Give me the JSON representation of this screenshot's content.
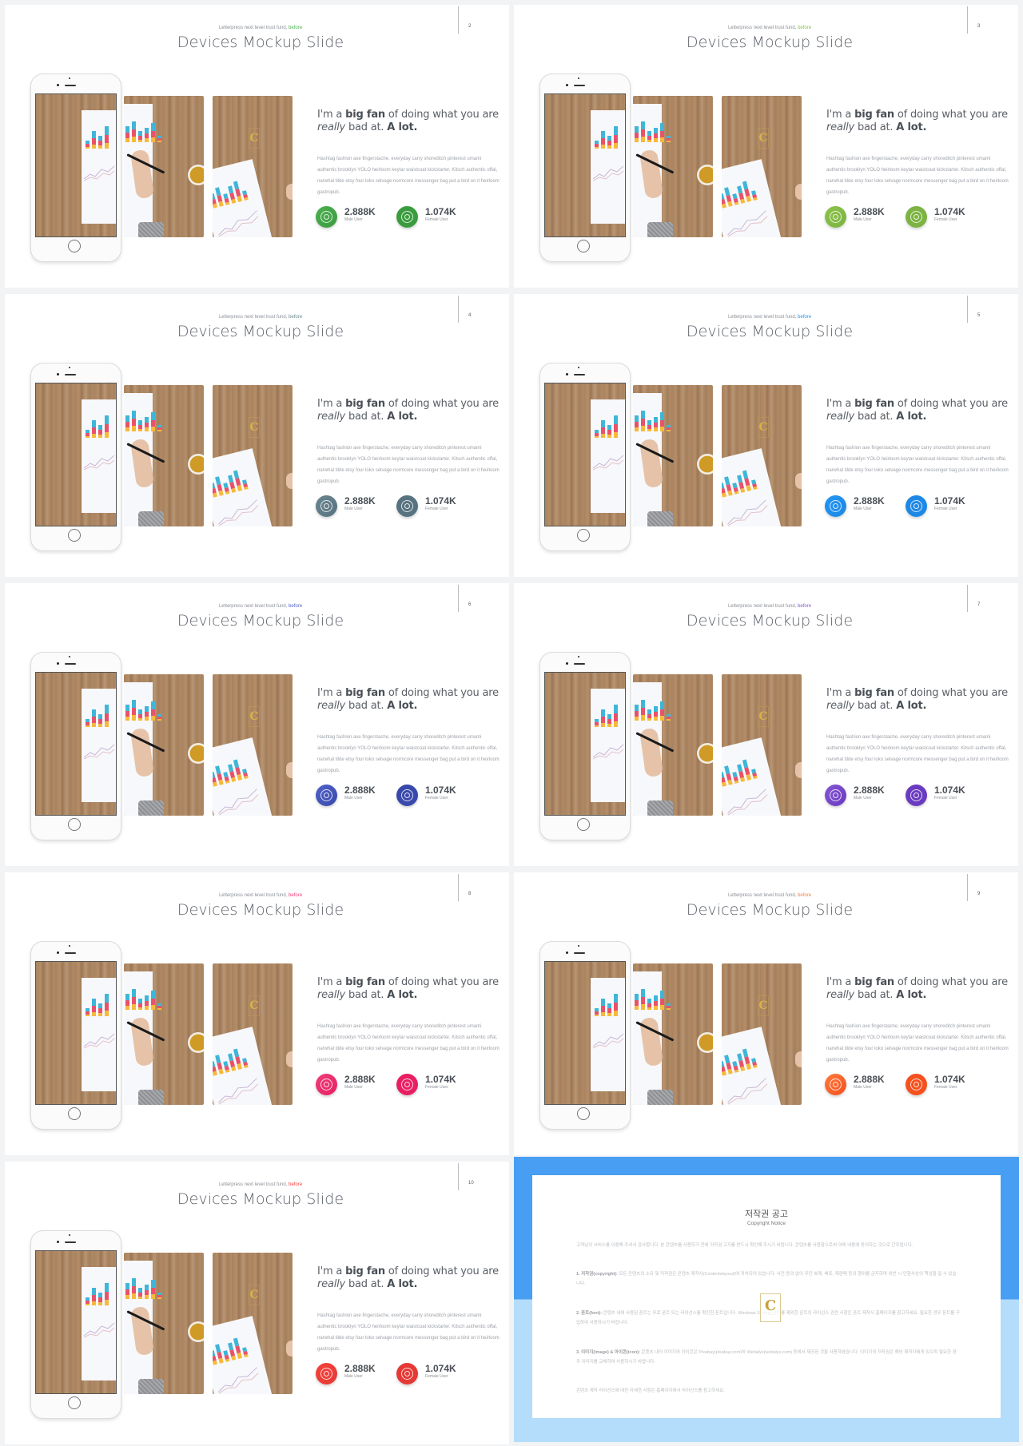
{
  "slides": [
    {
      "page": "2",
      "kicker": "Letterpress next level trust fund,",
      "kicker_accent": "before",
      "title": "Devices Mockup Slide",
      "heading_pre": "I'm a ",
      "heading_bold": "big fan",
      "heading_mid": " of doing what you are",
      "heading_em": "really",
      "heading_post": " bad at. ",
      "heading_end": "A lot.",
      "body": "Hashtag fashion axe fingerstache, everyday carry shoreditch pinterest umami authentic brooklyn YOLO heirloom keytar waistcoat kickstarter. Kitsch authentic offal, narwhal tilde etsy four loko selvage normcore messenger bag put a bird on it heirloom gastropub.",
      "stats": [
        {
          "value": "2.888K",
          "label": "Male User",
          "icon": "male-user-icon"
        },
        {
          "value": "1.074K",
          "label": "Female User",
          "icon": "female-user-icon"
        }
      ],
      "accent": "#4caf50",
      "accent_dark": "#3a9c3f"
    },
    {
      "page": "3",
      "kicker": "Letterpress next level trust fund,",
      "kicker_accent": "before",
      "title": "Devices Mockup Slide",
      "heading_pre": "I'm a ",
      "heading_bold": "big fan",
      "heading_mid": " of doing what you are",
      "heading_em": "really",
      "heading_post": " bad at. ",
      "heading_end": "A lot.",
      "body": "Hashtag fashion axe fingerstache, everyday carry shoreditch pinterest umami authentic brooklyn YOLO heirloom keytar waistcoat kickstarter. Kitsch authentic offal, narwhal tilde etsy four loko selvage normcore messenger bag put a bird on it heirloom gastropub.",
      "stats": [
        {
          "value": "2.888K",
          "label": "Male User",
          "icon": "male-user-icon"
        },
        {
          "value": "1.074K",
          "label": "Female User",
          "icon": "female-user-icon"
        }
      ],
      "accent": "#8bc34a",
      "accent_dark": "#7cb342"
    },
    {
      "page": "4",
      "kicker": "Letterpress next level trust fund,",
      "kicker_accent": "before",
      "title": "Devices Mockup Slide",
      "heading_pre": "I'm a ",
      "heading_bold": "big fan",
      "heading_mid": " of doing what you are",
      "heading_em": "really",
      "heading_post": " bad at. ",
      "heading_end": "A lot.",
      "body": "Hashtag fashion axe fingerstache, everyday carry shoreditch pinterest umami authentic brooklyn YOLO heirloom keytar waistcoat kickstarter. Kitsch authentic offal, narwhal tilde etsy four loko selvage normcore messenger bag put a bird on it heirloom gastropub.",
      "stats": [
        {
          "value": "2.888K",
          "label": "Male User",
          "icon": "male-user-icon"
        },
        {
          "value": "1.074K",
          "label": "Female User",
          "icon": "female-user-icon"
        }
      ],
      "accent": "#6b8591",
      "accent_dark": "#587380"
    },
    {
      "page": "5",
      "kicker": "Letterpress next level trust fund,",
      "kicker_accent": "before",
      "title": "Devices Mockup Slide",
      "heading_pre": "I'm a ",
      "heading_bold": "big fan",
      "heading_mid": " of doing what you are",
      "heading_em": "really",
      "heading_post": " bad at. ",
      "heading_end": "A lot.",
      "body": "Hashtag fashion axe fingerstache, everyday carry shoreditch pinterest umami authentic brooklyn YOLO heirloom keytar waistcoat kickstarter. Kitsch authentic offal, narwhal tilde etsy four loko selvage normcore messenger bag put a bird on it heirloom gastropub.",
      "stats": [
        {
          "value": "2.888K",
          "label": "Male User",
          "icon": "male-user-icon"
        },
        {
          "value": "1.074K",
          "label": "Female User",
          "icon": "female-user-icon"
        }
      ],
      "accent": "#2196f3",
      "accent_dark": "#1e88e5"
    },
    {
      "page": "6",
      "kicker": "Letterpress next level trust fund,",
      "kicker_accent": "before",
      "title": "Devices Mockup Slide",
      "heading_pre": "I'm a ",
      "heading_bold": "big fan",
      "heading_mid": " of doing what you are",
      "heading_em": "really",
      "heading_post": " bad at. ",
      "heading_end": "A lot.",
      "body": "Hashtag fashion axe fingerstache, everyday carry shoreditch pinterest umami authentic brooklyn YOLO heirloom keytar waistcoat kickstarter. Kitsch authentic offal, narwhal tilde etsy four loko selvage normcore messenger bag put a bird on it heirloom gastropub.",
      "stats": [
        {
          "value": "2.888K",
          "label": "Male User",
          "icon": "male-user-icon"
        },
        {
          "value": "1.074K",
          "label": "Female User",
          "icon": "female-user-icon"
        }
      ],
      "accent": "#5063c9",
      "accent_dark": "#3949ab"
    },
    {
      "page": "7",
      "kicker": "Letterpress next level trust fund,",
      "kicker_accent": "before",
      "title": "Devices Mockup Slide",
      "heading_pre": "I'm a ",
      "heading_bold": "big fan",
      "heading_mid": " of doing what you are",
      "heading_em": "really",
      "heading_post": " bad at. ",
      "heading_end": "A lot.",
      "body": "Hashtag fashion axe fingerstache, everyday carry shoreditch pinterest umami authentic brooklyn YOLO heirloom keytar waistcoat kickstarter. Kitsch authentic offal, narwhal tilde etsy four loko selvage normcore messenger bag put a bird on it heirloom gastropub.",
      "stats": [
        {
          "value": "2.888K",
          "label": "Male User",
          "icon": "male-user-icon"
        },
        {
          "value": "1.074K",
          "label": "Female User",
          "icon": "female-user-icon"
        }
      ],
      "accent": "#8556d4",
      "accent_dark": "#6a3bc0"
    },
    {
      "page": "8",
      "kicker": "Letterpress next level trust fund,",
      "kicker_accent": "before",
      "title": "Devices Mockup Slide",
      "heading_pre": "I'm a ",
      "heading_bold": "big fan",
      "heading_mid": " of doing what you are",
      "heading_em": "really",
      "heading_post": " bad at. ",
      "heading_end": "A lot.",
      "body": "Hashtag fashion axe fingerstache, everyday carry shoreditch pinterest umami authentic brooklyn YOLO heirloom keytar waistcoat kickstarter. Kitsch authentic offal, narwhal tilde etsy four loko selvage normcore messenger bag put a bird on it heirloom gastropub.",
      "stats": [
        {
          "value": "2.888K",
          "label": "Male User",
          "icon": "male-user-icon"
        },
        {
          "value": "1.074K",
          "label": "Female User",
          "icon": "female-user-icon"
        }
      ],
      "accent": "#ec407a",
      "accent_dark": "#e91e63"
    },
    {
      "page": "9",
      "kicker": "Letterpress next level trust fund,",
      "kicker_accent": "before",
      "title": "Devices Mockup Slide",
      "heading_pre": "I'm a ",
      "heading_bold": "big fan",
      "heading_mid": " of doing what you are",
      "heading_em": "really",
      "heading_post": " bad at. ",
      "heading_end": "A lot.",
      "body": "Hashtag fashion axe fingerstache, everyday carry shoreditch pinterest umami authentic brooklyn YOLO heirloom keytar waistcoat kickstarter. Kitsch authentic offal, narwhal tilde etsy four loko selvage normcore messenger bag put a bird on it heirloom gastropub.",
      "stats": [
        {
          "value": "2.888K",
          "label": "Male User",
          "icon": "male-user-icon"
        },
        {
          "value": "1.074K",
          "label": "Female User",
          "icon": "female-user-icon"
        }
      ],
      "accent": "#ff7a3d",
      "accent_dark": "#f4511e"
    },
    {
      "page": "10",
      "kicker": "Letterpress next level trust fund,",
      "kicker_accent": "before",
      "title": "Devices Mockup Slide",
      "heading_pre": "I'm a ",
      "heading_bold": "big fan",
      "heading_mid": " of doing what you are",
      "heading_em": "really",
      "heading_post": " bad at. ",
      "heading_end": "A lot.",
      "body": "Hashtag fashion axe fingerstache, everyday carry shoreditch pinterest umami authentic brooklyn YOLO heirloom keytar waistcoat kickstarter. Kitsch authentic offal, narwhal tilde etsy four loko selvage normcore messenger bag put a bird on it heirloom gastropub.",
      "stats": [
        {
          "value": "2.888K",
          "label": "Male User",
          "icon": "male-user-icon"
        },
        {
          "value": "1.074K",
          "label": "Female User",
          "icon": "female-user-icon"
        }
      ],
      "accent": "#f4433a",
      "accent_dark": "#e53935"
    }
  ],
  "copyright": {
    "title": "저작권 공고",
    "subtitle": "Copyright Notice",
    "intro": "고객님의 서비스를 이용해 주셔서 감사합니다. 본 콘텐츠를 사용하기 전에 저작권 고지를 반드시 확인해 주시기 바랍니다. 콘텐츠를 사용함으로써 아래 내용에 동의하는 것으로 간주됩니다.",
    "sections": [
      {
        "label": "1. 저작권(copyright):",
        "text": "모든 콘텐츠의 소유 및 저작권은 콘텐츠 제작사(Contentslayout)에 귀속되어 있습니다. 사전 동의 없이 무단 복제, 배포, 재판매 등의 행위를 금지하며 위반 시 민형사상의 책임을 질 수 있습니다."
      },
      {
        "label": "2. 폰트(font):",
        "text": "콘텐츠 내에 사용된 폰트는 무료 폰트 또는 라이선스를 확인한 폰트입니다. Windows System 폰트를 제외한 폰트의 라이선스 관련 사항은 폰트 제작사 홈페이지를 참고하세요. 필요한 경우 폰트를 구입하여 사용하시기 바랍니다."
      },
      {
        "label": "3. 이미지(image) & 아이콘(icon):",
        "text": "콘텐츠 내의 이미지와 아이콘은 Pixabay(pixabay.com)와 Webalys(webalys.com) 등에서 제공된 것을 사용하였습니다. 이미지의 저작권은 해당 제작자에게 있으며 필요한 경우 이미지를 교체하여 사용하시기 바랍니다."
      }
    ],
    "footer": "콘텐츠 제작 라이선스에 대한 자세한 사항은 홈페이지에서 라이선스를 참고하세요.",
    "logo_letter": "C"
  },
  "photo_colors": {
    "chart_blue": "#3fb6d8",
    "chart_red": "#e8526a",
    "chart_yellow": "#f6b93b",
    "wood": "#ab8562"
  }
}
